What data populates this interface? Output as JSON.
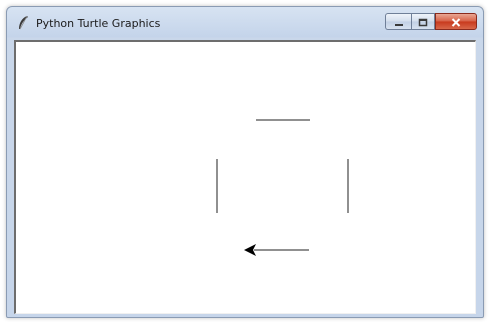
{
  "window": {
    "title": "Python Turtle Graphics",
    "icon": "feather-icon"
  },
  "caption_buttons": [
    {
      "name": "minimize-button",
      "icon": "minimize-icon"
    },
    {
      "name": "maximize-button",
      "icon": "maximize-icon"
    },
    {
      "name": "close-button",
      "icon": "close-icon",
      "color": "#d0462b"
    }
  ],
  "canvas": {
    "background": "#ffffff",
    "pen_color": "#6b6b6b",
    "turtle_color": "#000000",
    "turtle_shape": "classic-arrow",
    "turtle_heading": "left"
  }
}
